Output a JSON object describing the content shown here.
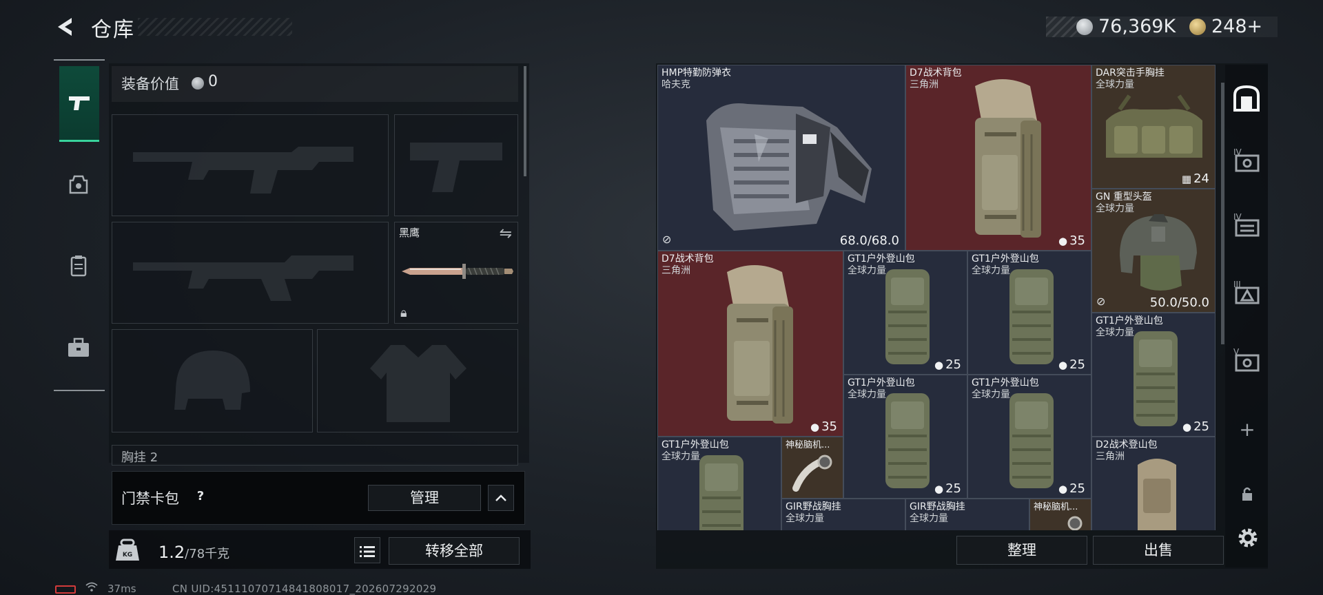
{
  "header": {
    "title": "仓库",
    "currency_silver": "76,369K",
    "currency_gold": "248+"
  },
  "left_rail": {
    "items": [
      {
        "name": "weapons",
        "icon": "pistol-icon",
        "active": true
      },
      {
        "name": "helmet-armor",
        "icon": "armor-icon",
        "active": false
      },
      {
        "name": "vest",
        "icon": "vest-icon",
        "active": false
      },
      {
        "name": "case",
        "icon": "toolbox-icon",
        "active": false
      }
    ]
  },
  "loadout": {
    "equip_value_label": "装备价值",
    "equip_value": "0",
    "melee_slot_name": "黑鹰",
    "chest_partial_label": "胸挂",
    "chest_partial_count": "2"
  },
  "keycard": {
    "label": "门禁卡包",
    "help": "?",
    "manage_label": "管理"
  },
  "weight": {
    "current": "1.2",
    "max": "/78千克",
    "transfer_all_label": "转移全部"
  },
  "status": {
    "ping": "37ms",
    "uid": "CN UID:451110707148418080​17_202607292029"
  },
  "stash": {
    "sort_label": "整理",
    "sell_label": "出售",
    "items": [
      {
        "id": "hmp-vest",
        "name": "HMP特勤防弹衣",
        "sub": "哈夫克",
        "stat": "68.0/68.0",
        "stat_kind": "durability",
        "color": "dark"
      },
      {
        "id": "d7-backpack-1",
        "name": "D7战术背包",
        "sub": "三角洲",
        "stat": "35",
        "stat_kind": "capacity",
        "color": "red"
      },
      {
        "id": "dar-rig",
        "name": "DAR突击手胸挂",
        "sub": "全球力量",
        "stat": "24",
        "stat_kind": "slots",
        "color": "brown"
      },
      {
        "id": "gn-helmet",
        "name": "GN 重型头盔",
        "sub": "全球力量",
        "stat": "50.0/50.0",
        "stat_kind": "durability",
        "color": "brown"
      },
      {
        "id": "d7-backpack-2",
        "name": "D7战术背包",
        "sub": "三角洲",
        "stat": "35",
        "stat_kind": "capacity",
        "color": "red"
      },
      {
        "id": "gt1-1",
        "name": "GT1户外登山包",
        "sub": "全球力量",
        "stat": "25",
        "stat_kind": "capacity",
        "color": "dark"
      },
      {
        "id": "gt1-2",
        "name": "GT1户外登山包",
        "sub": "全球力量",
        "stat": "25",
        "stat_kind": "capacity",
        "color": "dark"
      },
      {
        "id": "gt1-3",
        "name": "GT1户外登山包",
        "sub": "全球力量",
        "stat": "25",
        "stat_kind": "capacity",
        "color": "dark"
      },
      {
        "id": "gt1-4",
        "name": "GT1户外登山包",
        "sub": "全球力量",
        "stat": "25",
        "stat_kind": "capacity",
        "color": "dark"
      },
      {
        "id": "gt1-5",
        "name": "GT1户外登山包",
        "sub": "全球力量",
        "stat": "25",
        "stat_kind": "capacity",
        "color": "dark"
      },
      {
        "id": "gt1-6",
        "name": "GT1户外登山包",
        "sub": "全球力量",
        "stat": "",
        "stat_kind": "capacity",
        "color": "dark"
      },
      {
        "id": "mystery-1",
        "name": "神秘脑机...",
        "sub": "",
        "stat": "",
        "stat_kind": "",
        "color": "brown"
      },
      {
        "id": "d2-backpack",
        "name": "D2战术登山包",
        "sub": "三角洲",
        "stat": "",
        "stat_kind": "capacity",
        "color": "dark"
      },
      {
        "id": "gir-rig-1",
        "name": "GIR野战胸挂",
        "sub": "全球力量",
        "stat": "",
        "stat_kind": "",
        "color": "dark"
      },
      {
        "id": "gir-rig-2",
        "name": "GIR野战胸挂",
        "sub": "全球力量",
        "stat": "",
        "stat_kind": "",
        "color": "dark"
      },
      {
        "id": "mystery-2",
        "name": "神秘脑机...",
        "sub": "",
        "stat": "",
        "stat_kind": "",
        "color": "brown"
      }
    ]
  },
  "right_rail": {
    "items": [
      {
        "icon": "vault-icon",
        "label": ""
      },
      {
        "icon": "stash-iv-icon",
        "label": "IV"
      },
      {
        "icon": "stash-iv-2-icon",
        "label": "IV"
      },
      {
        "icon": "stash-iii-icon",
        "label": "III"
      },
      {
        "icon": "stash-v-icon",
        "label": "V"
      },
      {
        "icon": "add-icon",
        "label": "+"
      },
      {
        "icon": "lock-icon",
        "label": ""
      },
      {
        "icon": "settings-icon",
        "label": ""
      }
    ]
  },
  "colors": {
    "accent_green": "#39d39c",
    "item_red": "#5a2529",
    "item_brown": "#3e3328",
    "item_dark": "#262c3c"
  }
}
